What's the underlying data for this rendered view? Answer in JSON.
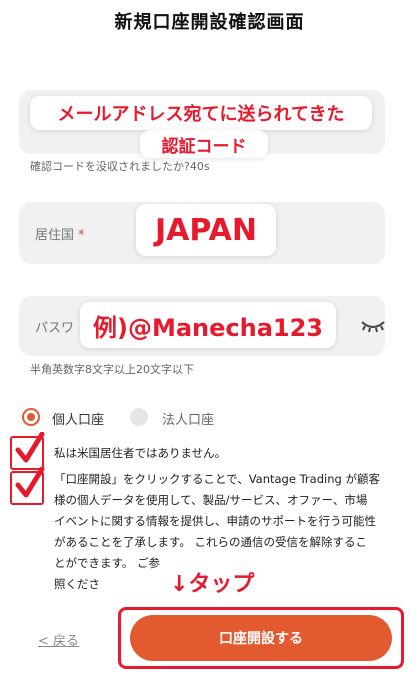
{
  "header": {
    "title": "新規口座開設確認画面"
  },
  "code": {
    "annotation_line1": "メールアドレス宛てに送られてきた",
    "annotation_line2": "認証コード",
    "resend_text": "確認コードを没収されましたか?40s"
  },
  "country": {
    "label": "居住国",
    "required_mark": "*",
    "value": "JAPAN"
  },
  "password": {
    "label": "パスワ",
    "example": "例)@Manecha123",
    "helper": "半角英数字8文字以上20文字以下",
    "eye_icon": "eye-closed-icon"
  },
  "account_type": {
    "options": [
      "個人口座",
      "法人口座"
    ],
    "selected": "個人口座"
  },
  "checks": {
    "not_us_resident": "私は米国居住者ではありません。",
    "consent": "「口座開設」をクリックすることで、Vantage Trading が顧客\n様の個人データを使用して、製品/サービス、オファー、市場\nイベントに関する情報を提供し、申請のサポートを行う可能性\nがあることを了承します。 これらの通信の受信を解除するこ\nとができます。                                                ご参\n照くださ"
  },
  "annotation": {
    "tap": "↓タップ"
  },
  "footer": {
    "back_label": "< 戻る",
    "submit_label": "口座開設する"
  },
  "colors": {
    "accent": "#e35a30",
    "annotation_red": "#e8192c",
    "field_bg": "#f1f1f1"
  }
}
